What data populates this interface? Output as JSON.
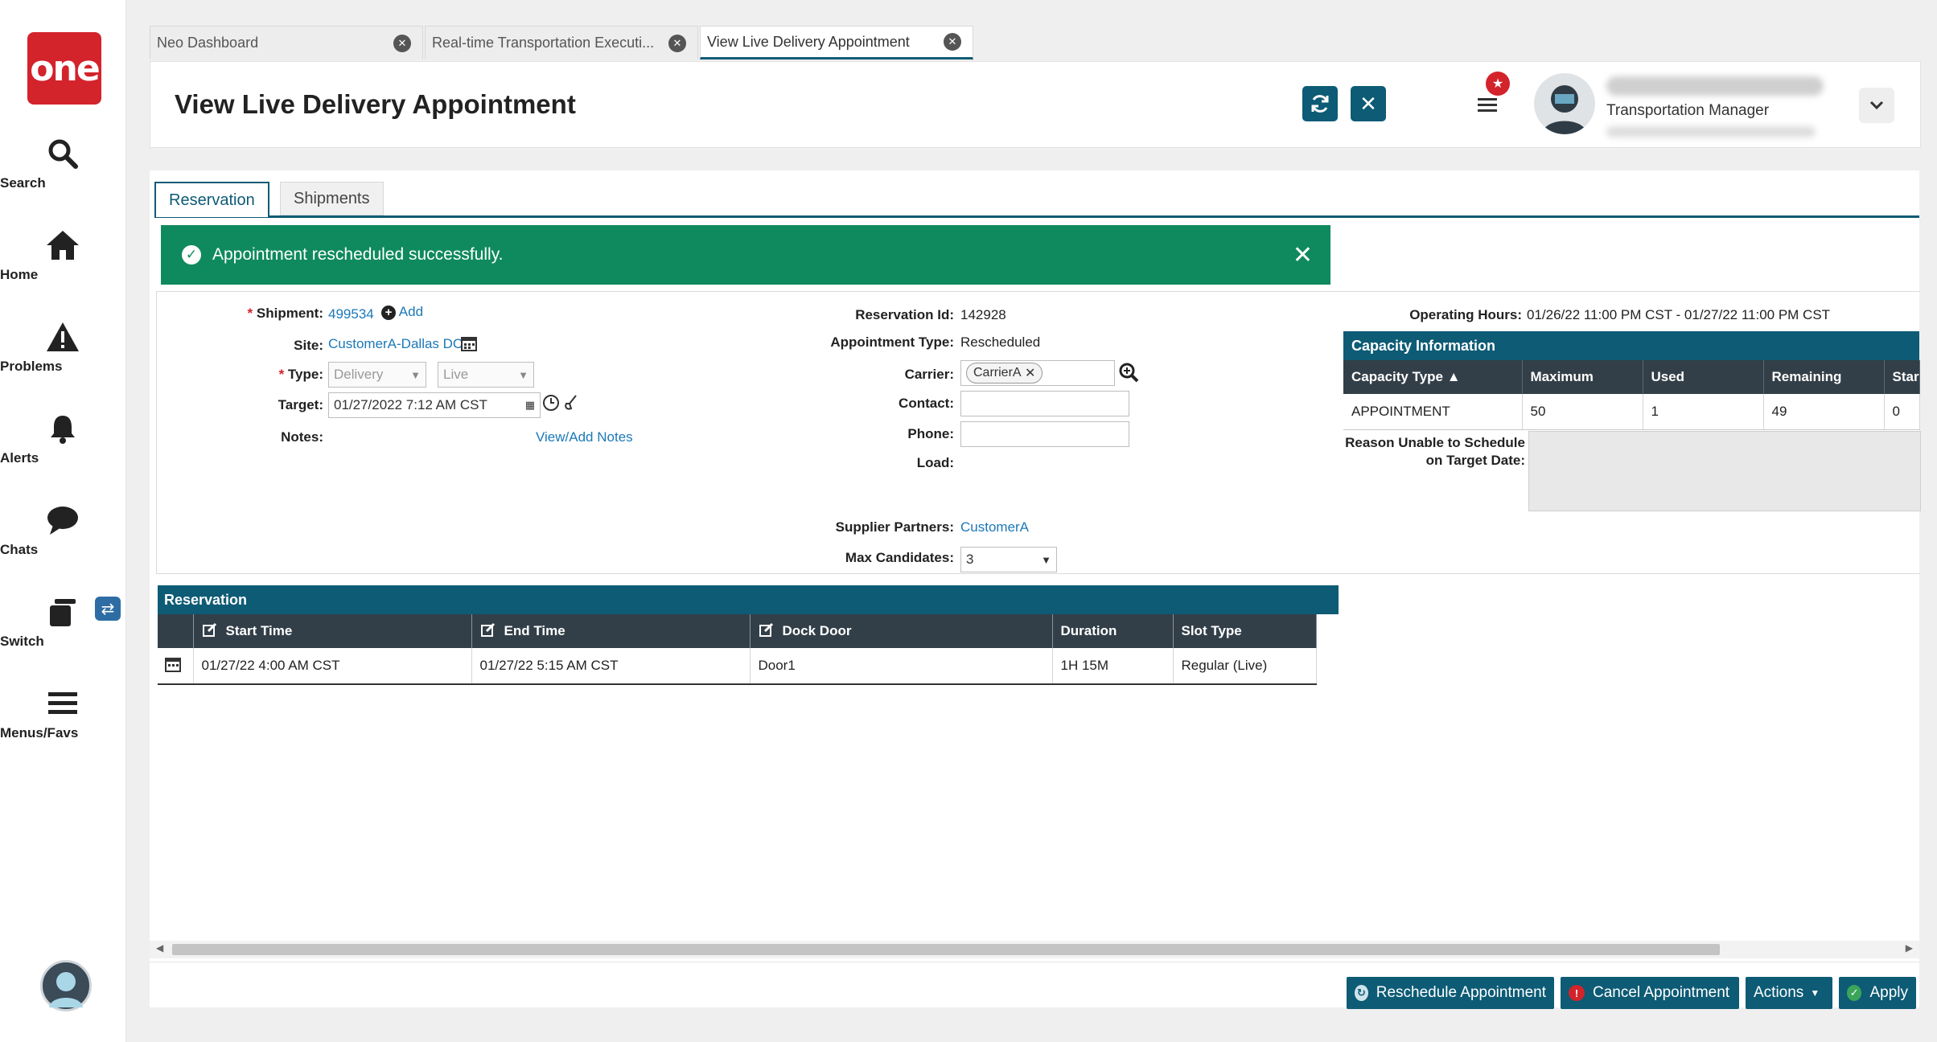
{
  "nav": {
    "logo_text": "one",
    "items": [
      {
        "label": "Search",
        "icon": "search-icon"
      },
      {
        "label": "Home",
        "icon": "home-icon"
      },
      {
        "label": "Problems",
        "icon": "warning-icon"
      },
      {
        "label": "Alerts",
        "icon": "bell-icon"
      },
      {
        "label": "Chats",
        "icon": "chat-icon"
      },
      {
        "label": "Switch",
        "icon": "switch-icon"
      },
      {
        "label": "Menus/Favs",
        "icon": "menu-icon"
      }
    ]
  },
  "doc_tabs": [
    {
      "label": "Neo Dashboard"
    },
    {
      "label": "Real-time Transportation Executi..."
    },
    {
      "label": "View Live Delivery Appointment"
    }
  ],
  "header": {
    "title": "View Live Delivery Appointment",
    "user_role": "Transportation Manager",
    "notification_badge": "★"
  },
  "content_tabs": [
    {
      "label": "Reservation"
    },
    {
      "label": "Shipments"
    }
  ],
  "success_message": "Appointment rescheduled successfully.",
  "form": {
    "shipment_label": "Shipment:",
    "shipment_value": "499534",
    "add_label": "Add",
    "site_label": "Site:",
    "site_value": "CustomerA-Dallas DC",
    "type_label": "Type:",
    "type_value": "Delivery",
    "type_mode_value": "Live",
    "target_label": "Target:",
    "target_value": "01/27/2022 7:12 AM CST",
    "notes_label": "Notes:",
    "view_add_notes": "View/Add Notes",
    "reservation_id_label": "Reservation Id:",
    "reservation_id_value": "142928",
    "appointment_type_label": "Appointment Type:",
    "appointment_type_value": "Rescheduled",
    "carrier_label": "Carrier:",
    "carrier_value": "CarrierA",
    "contact_label": "Contact:",
    "phone_label": "Phone:",
    "load_label": "Load:",
    "supplier_partners_label": "Supplier Partners:",
    "supplier_partners_value": "CustomerA",
    "max_candidates_label": "Max Candidates:",
    "max_candidates_value": "3",
    "operating_hours_label": "Operating Hours:",
    "operating_hours_value": "01/26/22 11:00 PM CST - 01/27/22 11:00 PM CST"
  },
  "capacity": {
    "title": "Capacity Information",
    "columns": [
      "Capacity Type ▲",
      "Maximum",
      "Used",
      "Remaining",
      "Star"
    ],
    "rows": [
      [
        "APPOINTMENT",
        "50",
        "1",
        "49",
        "0"
      ]
    ],
    "reason_label_line1": "Reason Unable to Schedule",
    "reason_label_line2": "on Target Date:"
  },
  "reservation": {
    "title": "Reservation",
    "columns": [
      "Start Time",
      "End Time",
      "Dock Door",
      "Duration",
      "Slot Type"
    ],
    "rows": [
      [
        "01/27/22 4:00 AM CST",
        "01/27/22 5:15 AM CST",
        "Door1",
        "1H 15M",
        "Regular (Live)"
      ]
    ]
  },
  "footer": {
    "reschedule": "Reschedule Appointment",
    "cancel": "Cancel Appointment",
    "actions": "Actions",
    "apply": "Apply"
  },
  "colors": {
    "accent": "#0d5b75",
    "success": "#0f8a5f",
    "brand": "#d3232b"
  }
}
